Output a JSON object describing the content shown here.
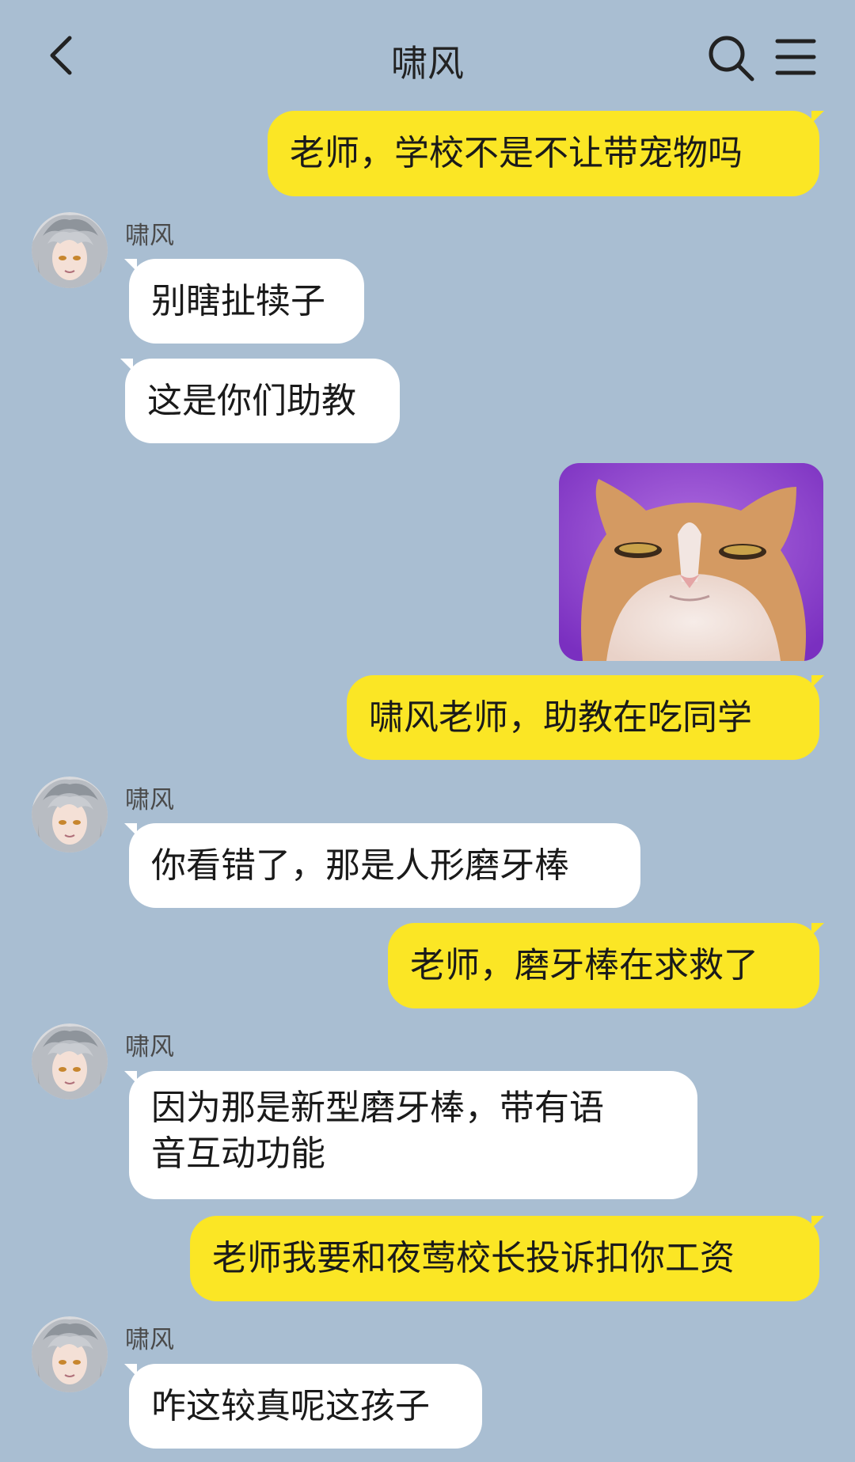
{
  "header": {
    "title": "啸风"
  },
  "messages": [
    {
      "from": "me",
      "text": "老师，学校不是不让带宠物吗"
    },
    {
      "from": "them",
      "sender": "啸风",
      "text": "别瞎扯犊子"
    },
    {
      "from": "them",
      "text": "这是你们助教"
    },
    {
      "from": "me",
      "image": "cat-meme-image"
    },
    {
      "from": "me",
      "text": "啸风老师，助教在吃同学"
    },
    {
      "from": "them",
      "sender": "啸风",
      "text": "你看错了，那是人形磨牙棒"
    },
    {
      "from": "me",
      "text": "老师，磨牙棒在求救了"
    },
    {
      "from": "them",
      "sender": "啸风",
      "text_line1": "因为那是新型磨牙棒，带有语",
      "text_line2": "音互动功能"
    },
    {
      "from": "me",
      "text": "老师我要和夜莺校长投诉扣你工资"
    },
    {
      "from": "them",
      "sender": "啸风",
      "text": "咋这较真呢这孩子"
    }
  ],
  "colors": {
    "background": "#a9bed2",
    "my_bubble": "#fbe625",
    "their_bubble": "#ffffff"
  },
  "icons": [
    "back-arrow-icon",
    "search-icon",
    "menu-icon"
  ]
}
